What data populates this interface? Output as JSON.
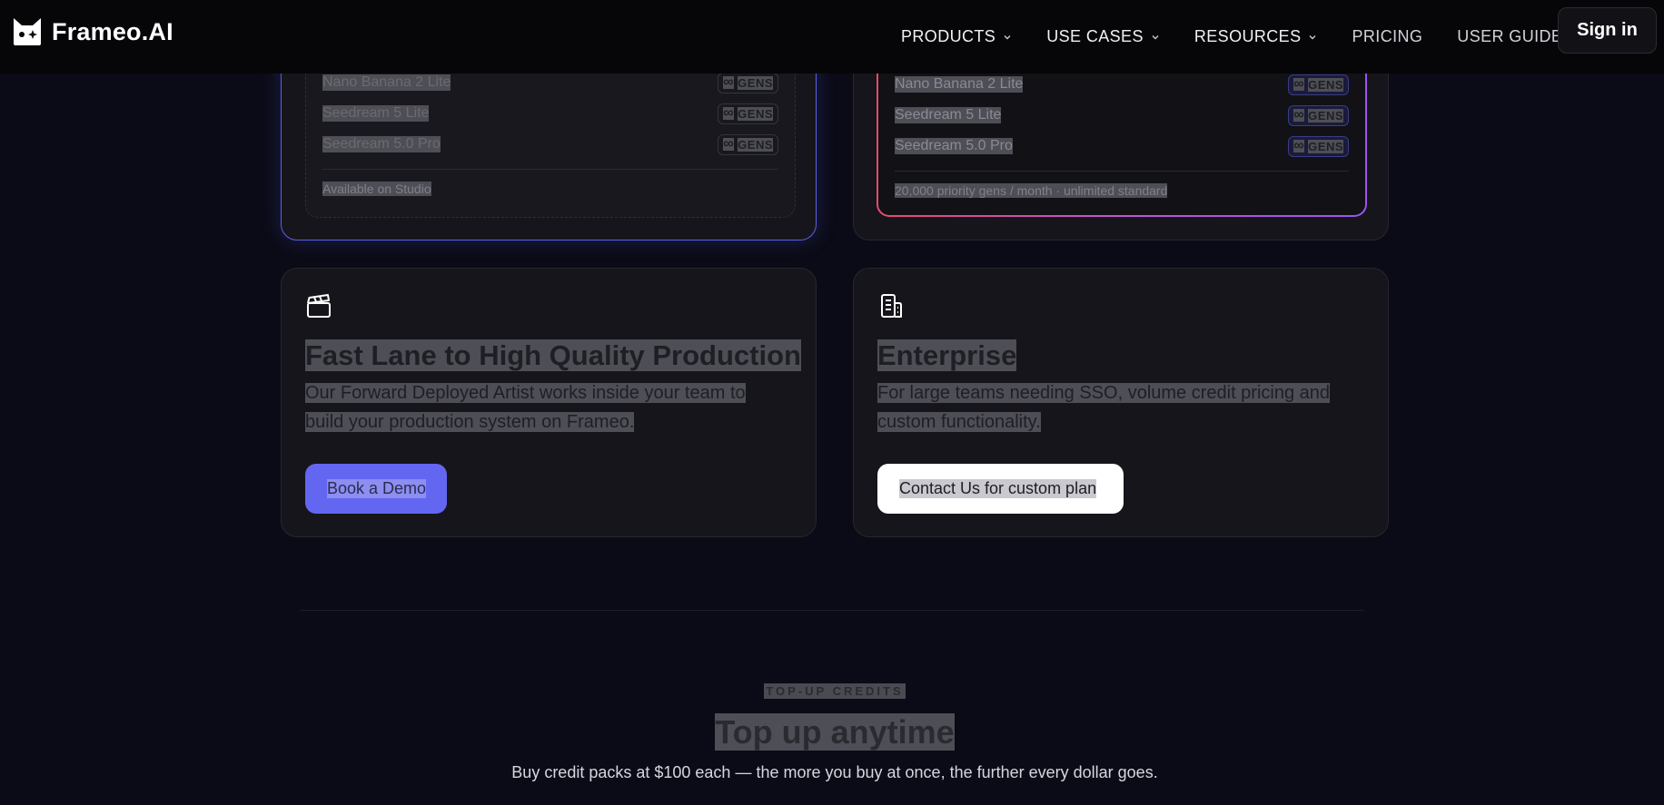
{
  "nav": {
    "brand": "Frameo.AI",
    "links": [
      {
        "label": "PRODUCTS"
      },
      {
        "label": "USE CASES"
      },
      {
        "label": "RESOURCES"
      },
      {
        "label": "PRICING"
      },
      {
        "label": "USER GUIDE"
      }
    ],
    "signin_label": "Sign in"
  },
  "plans": {
    "left": {
      "models": [
        {
          "name": "Nano Banana 2 Lite",
          "badge": "GENS",
          "symbol": "∞"
        },
        {
          "name": "Seedream 5 Lite",
          "badge": "GENS",
          "symbol": "∞"
        },
        {
          "name": "Seedream 5.0 Pro",
          "badge": "GENS",
          "symbol": "∞"
        }
      ],
      "footnote": "Available on Studio"
    },
    "right": {
      "models": [
        {
          "name": "Nano Banana 2 Lite",
          "badge": "GENS",
          "symbol": "∞"
        },
        {
          "name": "Seedream 5 Lite",
          "badge": "GENS",
          "symbol": "∞"
        },
        {
          "name": "Seedream 5.0 Pro",
          "badge": "GENS",
          "symbol": "∞"
        }
      ],
      "footnote": "20,000 priority gens / month · unlimited standard"
    }
  },
  "features": {
    "fast_lane": {
      "title": "Fast Lane to High Quality Production",
      "desc_line1": "Our Forward Deployed Artist works inside your team to",
      "desc_line2": "build your production system on Frameo.",
      "button": "Book a Demo"
    },
    "enterprise": {
      "title": "Enterprise",
      "desc_line1": "For large teams needing SSO, volume credit pricing and",
      "desc_line2": "custom functionality.",
      "button": "Contact Us for custom plan"
    }
  },
  "topup": {
    "eyebrow": "TOP-UP CREDITS",
    "title": "Top up anytime",
    "subtitle": "Buy credit packs at $100 each — the more you buy at once, the further every dollar goes."
  },
  "colors": {
    "background": "#0b0b17",
    "accent": "#6366f1",
    "gradient_start": "#e84a6d",
    "gradient_end": "#9a55f0"
  },
  "icons": {
    "brand": "cat-logo-icon",
    "fast_lane": "clapperboard-icon",
    "enterprise": "building-icon",
    "dropdown": "chevron-down-icon"
  }
}
